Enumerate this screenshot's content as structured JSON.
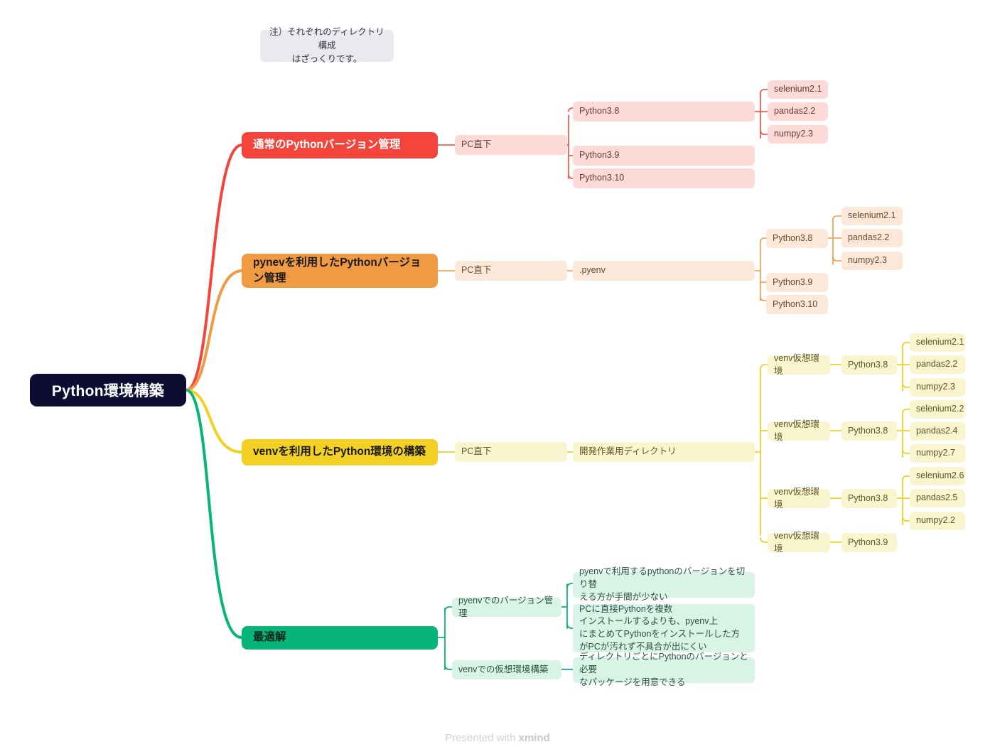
{
  "note": {
    "text": "注）それぞれのディレクトリ構成\nはざっくりです。"
  },
  "footer": {
    "prefix": "Presented with ",
    "brand": "xmind"
  },
  "root": {
    "label": "Python環境構築",
    "color": "#0d0d33"
  },
  "branches": [
    {
      "label": "通常のPythonバージョン管理",
      "color": "#f4453c",
      "sub_color": "#fbdad7",
      "level1": "PC直下",
      "level2": [
        "Python3.8",
        "Python3.9",
        "Python3.10"
      ],
      "level3": [
        "selenium2.1",
        "pandas2.2",
        "numpy2.3"
      ]
    },
    {
      "label": "pynevを利用したPythonバージョン管理",
      "color": "#f09a44",
      "sub_color": "#fbe8d8",
      "level1": "PC直下",
      "level2": ".pyenv",
      "level3": [
        "Python3.8",
        "Python3.9",
        "Python3.10"
      ],
      "level4": [
        "selenium2.1",
        "pandas2.2",
        "numpy2.3"
      ]
    },
    {
      "label": "venvを利用したPython環境の構築",
      "color": "#f2d024",
      "sub_color": "#faf4cf",
      "level1": "PC直下",
      "level2": "開発作業用ディレクトリ",
      "envs": [
        {
          "name": "venv仮想環境",
          "python": "Python3.8",
          "packages": [
            "selenium2.1",
            "pandas2.2",
            "numpy2.3"
          ]
        },
        {
          "name": "venv仮想環境",
          "python": "Python3.8",
          "packages": [
            "selenium2.2",
            "pandas2.4",
            "numpy2.7"
          ]
        },
        {
          "name": "venv仮想環境",
          "python": "Python3.8",
          "packages": [
            "selenium2.6",
            "pandas2.5",
            "numpy2.2"
          ]
        },
        {
          "name": "venv仮想環境",
          "python": "Python3.9",
          "packages": []
        }
      ]
    },
    {
      "label": "最適解",
      "color": "#07b579",
      "sub_color": "#d9f3e6",
      "topics": [
        {
          "name": "pyenvでのバージョン管理",
          "details": [
            "pyenvで利用するpythonのバージョンを切り替\nえる方が手間が少ない",
            "PCに直接Pythonを複数\nインストールするよりも、pyenv上\nにまとめてPythonをインストールした方\nがPCが汚れず不具合が出にくい"
          ]
        },
        {
          "name": "venvでの仮想環境構築",
          "details": [
            "ディレクトリごとにPythonのバージョンと必要\nなパッケージを用意できる"
          ]
        }
      ]
    }
  ]
}
